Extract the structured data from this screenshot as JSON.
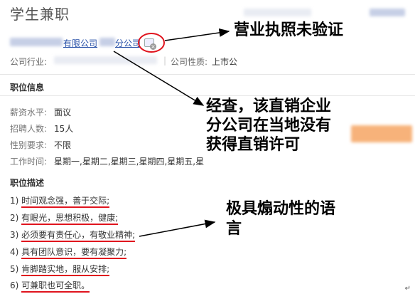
{
  "page": {
    "title": "学生兼职"
  },
  "company": {
    "name_suffix": "有限公司",
    "branch_suffix": "分公司",
    "industry_label": "公司行业:",
    "nature_label": "公司性质:",
    "nature_value": "上市公"
  },
  "job_info": {
    "section_title": "职位信息",
    "rows": [
      {
        "label": "薪资水平:",
        "value": "面议"
      },
      {
        "label": "招聘人数:",
        "value": "15人"
      },
      {
        "label": "性别要求:",
        "value": "不限"
      },
      {
        "label": "工作时间:",
        "value": "星期一,星期二,星期三,星期四,星期五,星"
      }
    ]
  },
  "job_desc": {
    "section_title": "职位描述",
    "items": [
      {
        "num": "1)",
        "text": "时间观念强，善于交际;"
      },
      {
        "num": "2)",
        "text": "有眼光，思想积极，健康;"
      },
      {
        "num": "3)",
        "text": "必须要有责任心，有敬业精神;"
      },
      {
        "num": "4)",
        "text": "具有团队意识，要有凝聚力;"
      },
      {
        "num": "5)",
        "text": "肯脚踏实地，服从安排;"
      },
      {
        "num": "6)",
        "text": "可兼职也可全职。"
      }
    ]
  },
  "annotations": {
    "license": "营业执照未验证",
    "direct_sales": "经查，该直销企业分公司在当地没有获得直销许可",
    "language": "极具煽动性的语言"
  },
  "colors": {
    "annotation_red": "#e0141e",
    "link_blue": "#2750a8"
  },
  "icons": {
    "cert": "license-unverified-icon"
  }
}
